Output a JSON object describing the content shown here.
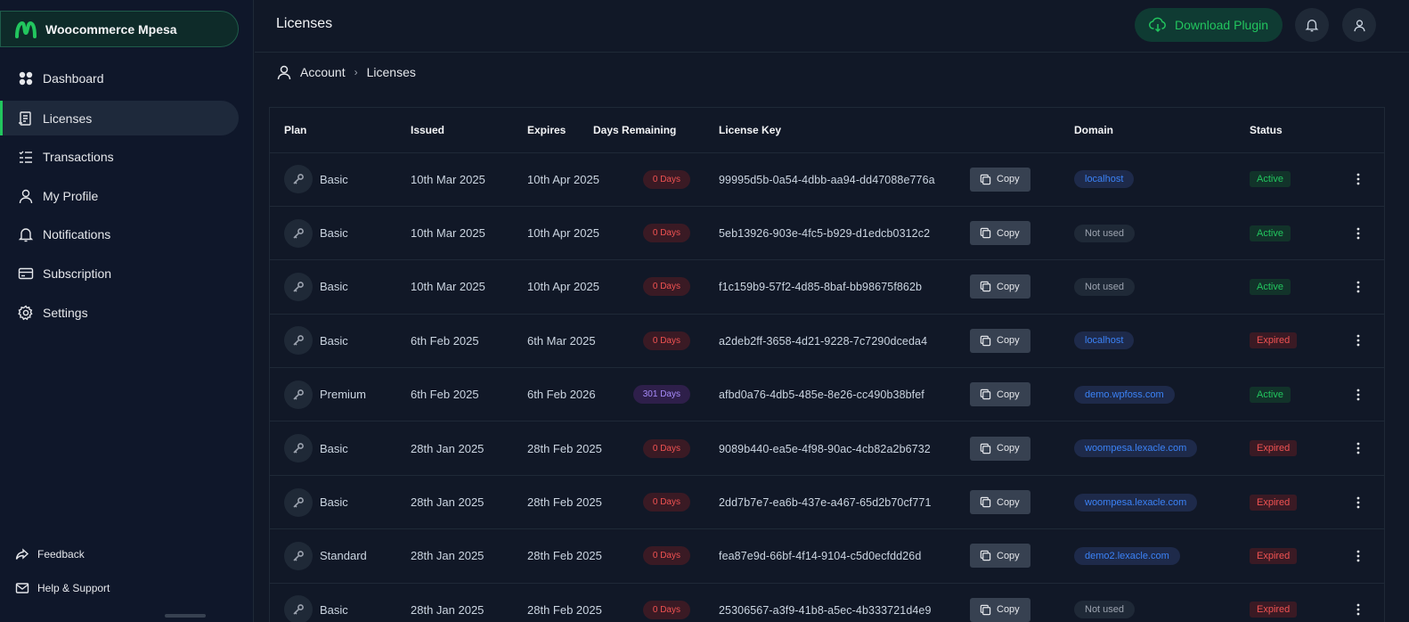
{
  "brand": {
    "name": "Woocommerce Mpesa",
    "accent": "#22c55e"
  },
  "sidebar": {
    "items": [
      {
        "label": "Dashboard",
        "icon": "dashboard-icon",
        "active": false
      },
      {
        "label": "Licenses",
        "icon": "license-icon",
        "active": true
      },
      {
        "label": "Transactions",
        "icon": "transactions-icon",
        "active": false
      },
      {
        "label": "My Profile",
        "icon": "user-icon",
        "active": false
      },
      {
        "label": "Notifications",
        "icon": "bell-icon",
        "active": false
      },
      {
        "label": "Subscription",
        "icon": "card-icon",
        "active": false
      },
      {
        "label": "Settings",
        "icon": "gear-icon",
        "active": false
      }
    ],
    "footer": [
      {
        "label": "Feedback",
        "icon": "share-icon"
      },
      {
        "label": "Help & Support",
        "icon": "mail-icon"
      }
    ]
  },
  "header": {
    "title": "Licenses",
    "download_label": "Download Plugin"
  },
  "breadcrumb": {
    "root": "Account",
    "current": "Licenses"
  },
  "table": {
    "columns": [
      "Plan",
      "Issued",
      "Expires",
      "Days Remaining",
      "License Key",
      "",
      "Domain",
      "Status",
      ""
    ],
    "copy_label": "Copy",
    "rows": [
      {
        "plan": "Basic",
        "issued": "10th Mar 2025",
        "expires": "10th Apr 2025",
        "days": "0 Days",
        "key": "99995d5b-0a54-4dbb-aa94-dd47088e776a",
        "domain": "localhost",
        "status": "Active"
      },
      {
        "plan": "Basic",
        "issued": "10th Mar 2025",
        "expires": "10th Apr 2025",
        "days": "0 Days",
        "key": "5eb13926-903e-4fc5-b929-d1edcb0312c2",
        "domain": "Not used",
        "status": "Active"
      },
      {
        "plan": "Basic",
        "issued": "10th Mar 2025",
        "expires": "10th Apr 2025",
        "days": "0 Days",
        "key": "f1c159b9-57f2-4d85-8baf-bb98675f862b",
        "domain": "Not used",
        "status": "Active"
      },
      {
        "plan": "Basic",
        "issued": "6th Feb 2025",
        "expires": "6th Mar 2025",
        "days": "0 Days",
        "key": "a2deb2ff-3658-4d21-9228-7c7290dceda4",
        "domain": "localhost",
        "status": "Expired"
      },
      {
        "plan": "Premium",
        "issued": "6th Feb 2025",
        "expires": "6th Feb 2026",
        "days": "301 Days",
        "key": "afbd0a76-4db5-485e-8e26-cc490b38bfef",
        "domain": "demo.wpfoss.com",
        "status": "Active"
      },
      {
        "plan": "Basic",
        "issued": "28th Jan 2025",
        "expires": "28th Feb 2025",
        "days": "0 Days",
        "key": "9089b440-ea5e-4f98-90ac-4cb82a2b6732",
        "domain": "woompesa.lexacle.com",
        "status": "Expired"
      },
      {
        "plan": "Basic",
        "issued": "28th Jan 2025",
        "expires": "28th Feb 2025",
        "days": "0 Days",
        "key": "2dd7b7e7-ea6b-437e-a467-65d2b70cf771",
        "domain": "woompesa.lexacle.com",
        "status": "Expired"
      },
      {
        "plan": "Standard",
        "issued": "28th Jan 2025",
        "expires": "28th Feb 2025",
        "days": "0 Days",
        "key": "fea87e9d-66bf-4f14-9104-c5d0ecfdd26d",
        "domain": "demo2.lexacle.com",
        "status": "Expired"
      },
      {
        "plan": "Basic",
        "issued": "28th Jan 2025",
        "expires": "28th Feb 2025",
        "days": "0 Days",
        "key": "25306567-a3f9-41b8-a5ec-4b333721d4e9",
        "domain": "Not used",
        "status": "Expired"
      }
    ]
  }
}
